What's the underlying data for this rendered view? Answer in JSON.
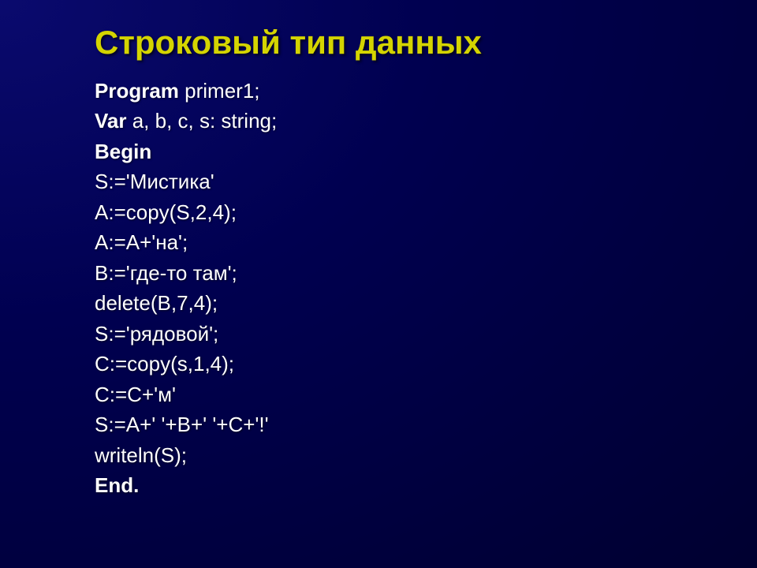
{
  "title": "Строковый тип данных",
  "lines": [
    {
      "parts": [
        {
          "text": "Program ",
          "bold": true
        },
        {
          "text": "primer1;",
          "bold": false
        }
      ]
    },
    {
      "parts": [
        {
          "text": "Var ",
          "bold": true
        },
        {
          "text": "a, b, c, s: string;",
          "bold": false
        }
      ]
    },
    {
      "parts": [
        {
          "text": "Begin",
          "bold": true
        }
      ]
    },
    {
      "parts": [
        {
          "text": "S:='Мистика'",
          "bold": false
        }
      ]
    },
    {
      "parts": [
        {
          "text": "A:=copy(S,2,4);",
          "bold": false
        }
      ]
    },
    {
      "parts": [
        {
          "text": "A:=A+'на';",
          "bold": false
        }
      ]
    },
    {
      "parts": [
        {
          "text": "B:='где-то там';",
          "bold": false
        }
      ]
    },
    {
      "parts": [
        {
          "text": "delete(B,7,4);",
          "bold": false
        }
      ]
    },
    {
      "parts": [
        {
          "text": "S:='рядовой';",
          "bold": false
        }
      ]
    },
    {
      "parts": [
        {
          "text": "C:=copy(s,1,4);",
          "bold": false
        }
      ]
    },
    {
      "parts": [
        {
          "text": "C:=C+'м'",
          "bold": false
        }
      ]
    },
    {
      "parts": [
        {
          "text": "S:=A+' '+B+' '+C+'!'",
          "bold": false
        }
      ]
    },
    {
      "parts": [
        {
          "text": "writeln(S);",
          "bold": false
        }
      ]
    },
    {
      "parts": [
        {
          "text": "End.",
          "bold": true
        }
      ]
    }
  ]
}
